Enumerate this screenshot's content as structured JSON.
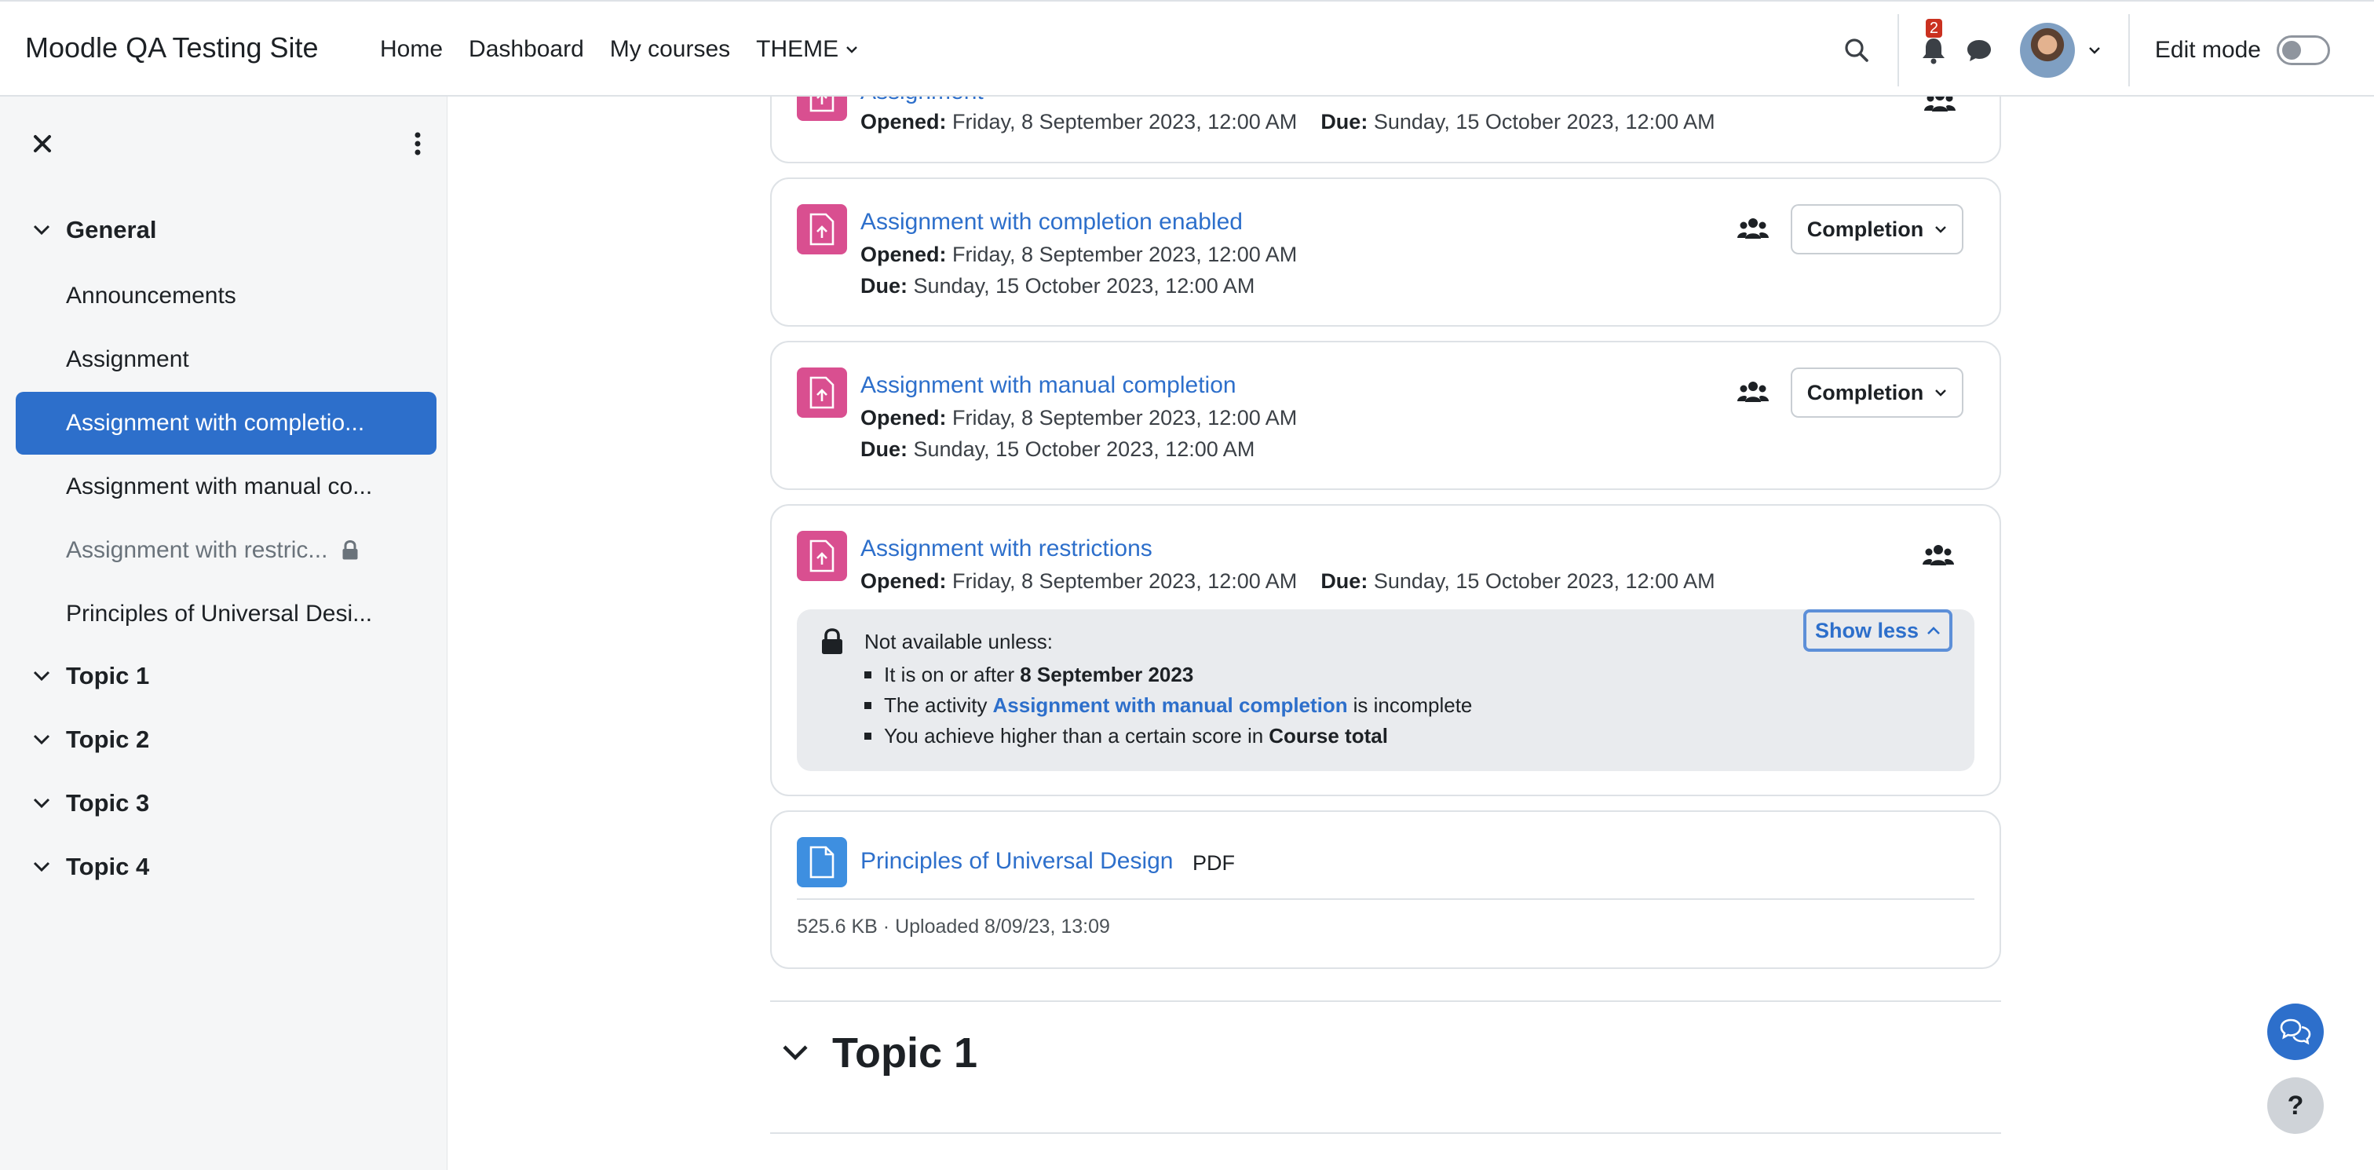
{
  "header": {
    "site_name": "Moodle QA Testing Site",
    "nav": [
      "Home",
      "Dashboard",
      "My courses",
      "THEME"
    ],
    "notification_count": "2",
    "edit_mode_label": "Edit mode"
  },
  "drawer": {
    "sections": [
      {
        "title": "General",
        "items": [
          {
            "label": "Announcements"
          },
          {
            "label": "Assignment"
          },
          {
            "label": "Assignment with completio...",
            "active": true
          },
          {
            "label": "Assignment with manual co..."
          },
          {
            "label": "Assignment with restric...",
            "locked": true
          },
          {
            "label": "Principles of Universal Desi..."
          }
        ]
      },
      {
        "title": "Topic 1"
      },
      {
        "title": "Topic 2"
      },
      {
        "title": "Topic 3"
      },
      {
        "title": "Topic 4"
      }
    ]
  },
  "activities": [
    {
      "title": "Assignment",
      "opened_label": "Opened:",
      "opened": "Friday, 8 September 2023, 12:00 AM",
      "due_label": "Due:",
      "due": "Sunday, 15 October 2023, 12:00 AM"
    },
    {
      "title": "Assignment with completion enabled",
      "opened_label": "Opened:",
      "opened": "Friday, 8 September 2023, 12:00 AM",
      "due_label": "Due:",
      "due": "Sunday, 15 October 2023, 12:00 AM",
      "completion_label": "Completion"
    },
    {
      "title": "Assignment with manual completion",
      "opened_label": "Opened:",
      "opened": "Friday, 8 September 2023, 12:00 AM",
      "due_label": "Due:",
      "due": "Sunday, 15 October 2023, 12:00 AM",
      "completion_label": "Completion"
    },
    {
      "title": "Assignment with restrictions",
      "opened_label": "Opened:",
      "opened": "Friday, 8 September 2023, 12:00 AM",
      "due_label": "Due:",
      "due": "Sunday, 15 October 2023, 12:00 AM",
      "restrictions": {
        "heading": "Not available unless:",
        "toggle_label": "Show less",
        "r1_text": "It is on or after",
        "r1_bold": "8 September 2023",
        "r2_text": "The activity",
        "r2_link": "Assignment with manual completion",
        "r2_tail": "is incomplete",
        "r3_text": "You achieve higher than a certain score in",
        "r3_bold": "Course total"
      }
    },
    {
      "title": "Principles of Universal Design",
      "type_label": "PDF",
      "file_meta": "525.6 KB · Uploaded 8/09/23, 13:09"
    }
  ],
  "section_heading": "Topic 1"
}
